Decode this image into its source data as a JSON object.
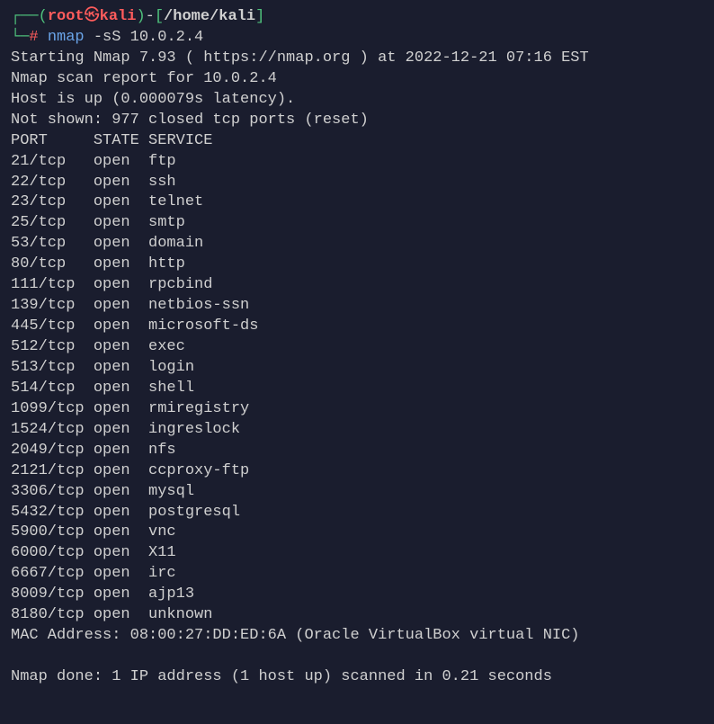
{
  "prompt": {
    "corner_top": "┌──",
    "corner_bottom": "└─",
    "open_paren": "(",
    "close_paren": ")",
    "user": "root",
    "skull": "㉿",
    "host": "kali",
    "dash": "-",
    "open_bracket": "[",
    "close_bracket": "]",
    "path": "/home/kali",
    "symbol": "#",
    "command": "nmap",
    "args": "-sS 10.0.2.4"
  },
  "output": {
    "line1": "Starting Nmap 7.93 ( https://nmap.org ) at 2022-12-21 07:16 EST",
    "line2": "Nmap scan report for 10.0.2.4",
    "line3": "Host is up (0.000079s latency).",
    "line4": "Not shown: 977 closed tcp ports (reset)",
    "header_port": "PORT",
    "header_state": "STATE",
    "header_service": "SERVICE",
    "ports": [
      {
        "port": "21/tcp",
        "state": "open",
        "service": "ftp"
      },
      {
        "port": "22/tcp",
        "state": "open",
        "service": "ssh"
      },
      {
        "port": "23/tcp",
        "state": "open",
        "service": "telnet"
      },
      {
        "port": "25/tcp",
        "state": "open",
        "service": "smtp"
      },
      {
        "port": "53/tcp",
        "state": "open",
        "service": "domain"
      },
      {
        "port": "80/tcp",
        "state": "open",
        "service": "http"
      },
      {
        "port": "111/tcp",
        "state": "open",
        "service": "rpcbind"
      },
      {
        "port": "139/tcp",
        "state": "open",
        "service": "netbios-ssn"
      },
      {
        "port": "445/tcp",
        "state": "open",
        "service": "microsoft-ds"
      },
      {
        "port": "512/tcp",
        "state": "open",
        "service": "exec"
      },
      {
        "port": "513/tcp",
        "state": "open",
        "service": "login"
      },
      {
        "port": "514/tcp",
        "state": "open",
        "service": "shell"
      },
      {
        "port": "1099/tcp",
        "state": "open",
        "service": "rmiregistry"
      },
      {
        "port": "1524/tcp",
        "state": "open",
        "service": "ingreslock"
      },
      {
        "port": "2049/tcp",
        "state": "open",
        "service": "nfs"
      },
      {
        "port": "2121/tcp",
        "state": "open",
        "service": "ccproxy-ftp"
      },
      {
        "port": "3306/tcp",
        "state": "open",
        "service": "mysql"
      },
      {
        "port": "5432/tcp",
        "state": "open",
        "service": "postgresql"
      },
      {
        "port": "5900/tcp",
        "state": "open",
        "service": "vnc"
      },
      {
        "port": "6000/tcp",
        "state": "open",
        "service": "X11"
      },
      {
        "port": "6667/tcp",
        "state": "open",
        "service": "irc"
      },
      {
        "port": "8009/tcp",
        "state": "open",
        "service": "ajp13"
      },
      {
        "port": "8180/tcp",
        "state": "open",
        "service": "unknown"
      }
    ],
    "mac": "MAC Address: 08:00:27:DD:ED:6A (Oracle VirtualBox virtual NIC)",
    "done": "Nmap done: 1 IP address (1 host up) scanned in 0.21 seconds"
  }
}
